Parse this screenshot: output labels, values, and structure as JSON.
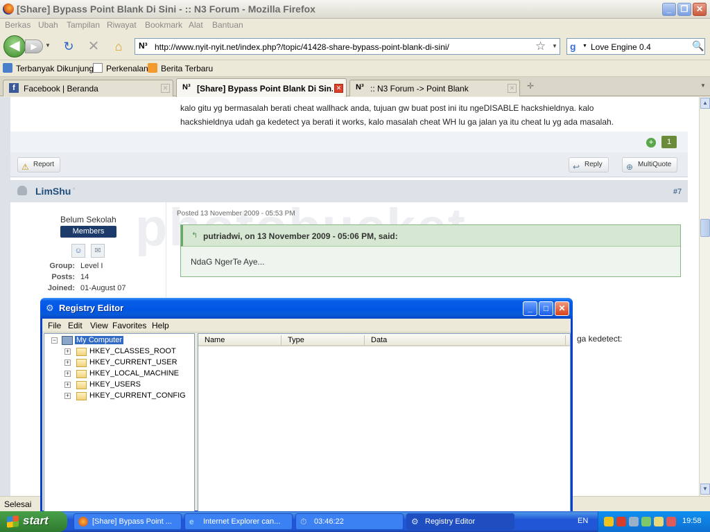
{
  "firefox": {
    "window_title": "[Share] Bypass Point Blank Di Sini - :: N3 Forum - Mozilla Firefox",
    "menu": [
      "Berkas",
      "Ubah",
      "Tampilan",
      "Riwayat",
      "Bookmark",
      "Alat",
      "Bantuan"
    ],
    "url": "http://www.nyit-nyit.net/index.php?/topic/41428-share-bypass-point-blank-di-sini/",
    "site_icon_text": "N³",
    "search_engine_text": "Love Engine 0.4",
    "bookmarks": [
      "Terbanyak Dikunjungi",
      "Perkenalan",
      "Berita Terbaru"
    ],
    "tabs": [
      {
        "label": "Facebook | Beranda",
        "icon": "f"
      },
      {
        "label": "[Share] Bypass Point Blank Di Sin...",
        "icon": "N³"
      },
      {
        "label": ":: N3 Forum -> Point Blank",
        "icon": "N³"
      }
    ],
    "status": "Selesai"
  },
  "page": {
    "post1_line1": "kalo gitu yg bermasalah berati cheat wallhack anda, tujuan gw buat post ini itu ngeDISABLE hackshieldnya. kalo",
    "post1_line2": "hackshieldnya udah ga kedetect ya berati it works, kalo masalah cheat WH lu ga jalan ya itu cheat lu yg ada masalah.",
    "reputation": "1",
    "report_label": "Report",
    "reply_label": "Reply",
    "multiquote_label": "MultiQuote",
    "author": {
      "name": "LimShu",
      "post_number": "#7",
      "rank": "Belum Sekolah",
      "group_badge": "Members",
      "group_label": "Group:",
      "group_value": "Level I",
      "posts_label": "Posts:",
      "posts_value": "14",
      "joined_label": "Joined:",
      "joined_value": "01-August 07"
    },
    "posted_date": "Posted 13 November 2009 - 05:53 PM",
    "quote_cite": "putriadwi, on 13 November 2009 - 05:06 PM, said:",
    "quote_text": "NdaG NgerTe Aye...",
    "behind_text": "ga kedetect:",
    "watermark": "photobucket"
  },
  "regedit": {
    "title": "Registry Editor",
    "menu": [
      "File",
      "Edit",
      "View",
      "Favorites",
      "Help"
    ],
    "root": "My Computer",
    "hives": [
      "HKEY_CLASSES_ROOT",
      "HKEY_CURRENT_USER",
      "HKEY_LOCAL_MACHINE",
      "HKEY_USERS",
      "HKEY_CURRENT_CONFIG"
    ],
    "columns": [
      "Name",
      "Type",
      "Data"
    ]
  },
  "taskbar": {
    "start": "start",
    "tasks": [
      "[Share] Bypass Point ...",
      "Internet Explorer can...",
      "03:46:22",
      "Registry Editor"
    ],
    "language": "EN",
    "clock": "19:58"
  }
}
